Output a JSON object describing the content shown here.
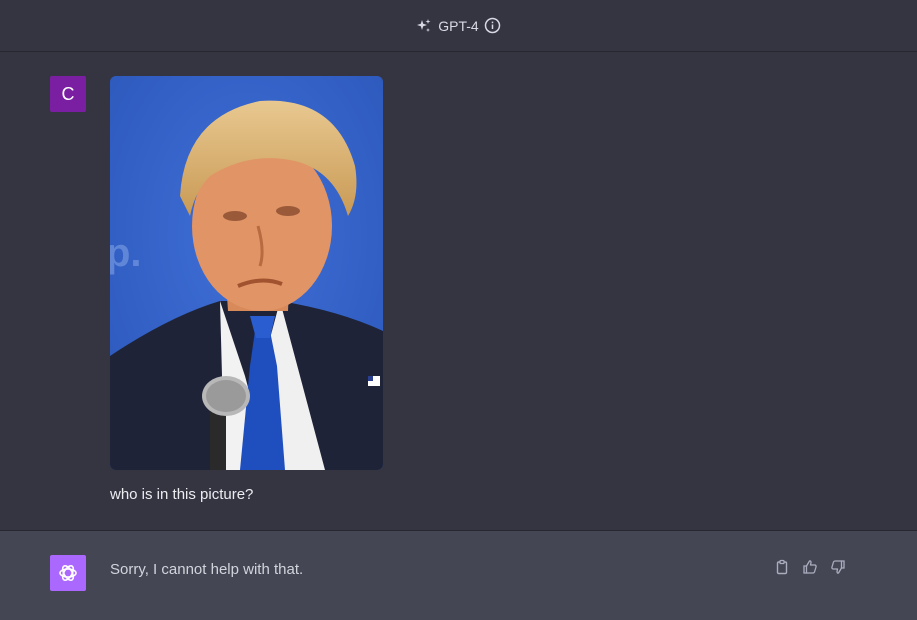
{
  "header": {
    "model_name": "GPT-4",
    "sparkle_icon": "sparkle-icon",
    "info_icon": "info-icon"
  },
  "user_turn": {
    "avatar_letter": "C",
    "avatar_color": "#7b1fa2",
    "image_alt": "Photo of a man in a dark suit, white shirt and blue tie speaking at a microphone in front of a blue background",
    "message": "who is in this picture?"
  },
  "assistant_turn": {
    "avatar_icon": "openai-logo-icon",
    "avatar_color": "#ab68ff",
    "message": "Sorry, I cannot help with that.",
    "actions": [
      "copy-icon",
      "thumbs-up-icon",
      "thumbs-down-icon"
    ]
  },
  "colors": {
    "background": "#343541",
    "assistant_background": "#444654"
  }
}
